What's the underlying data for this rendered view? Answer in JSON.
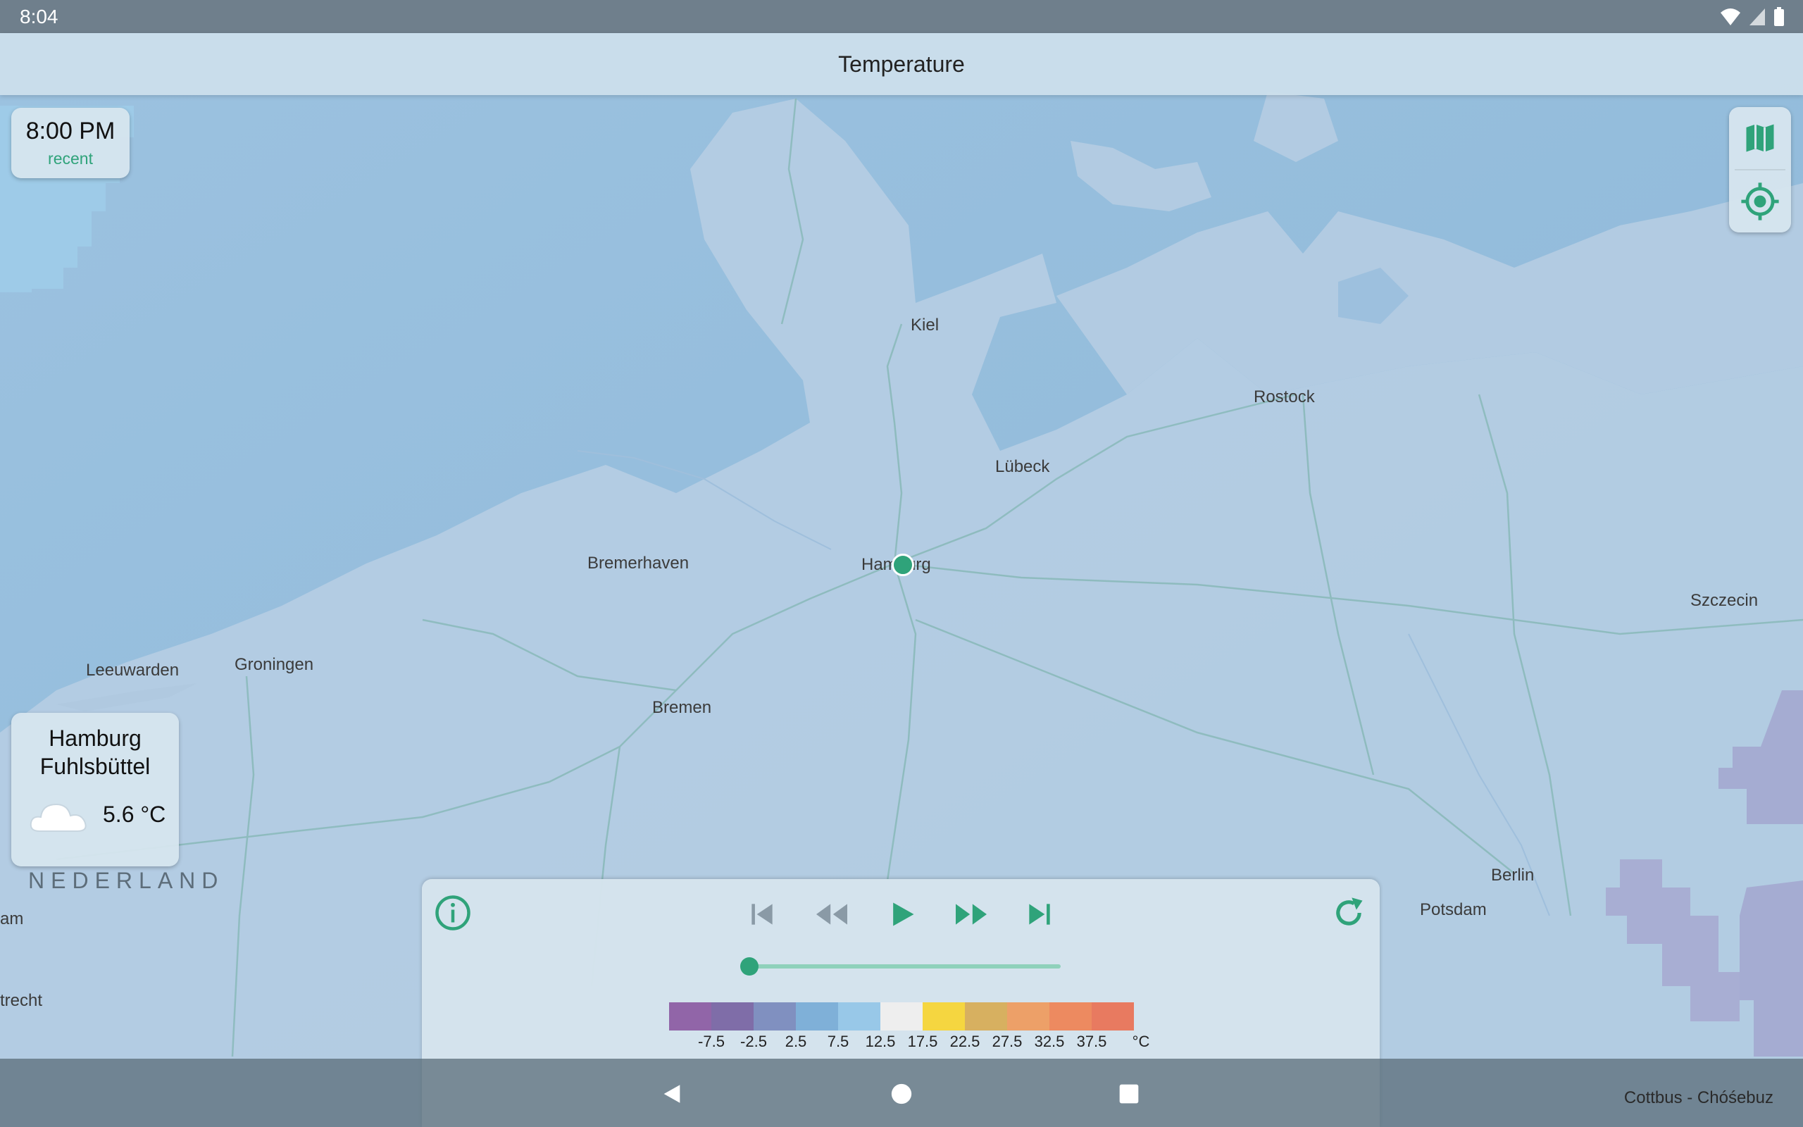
{
  "status_bar": {
    "time": "8:04"
  },
  "app_bar": {
    "title": "Temperature"
  },
  "time_card": {
    "time": "8:00 PM",
    "status": "recent"
  },
  "station_card": {
    "name_line1": "Hamburg",
    "name_line2": "Fuhlsbüttel",
    "temperature": "5.6 °C",
    "condition_icon": "cloud-icon"
  },
  "map": {
    "cities": [
      "Kiel",
      "Rostock",
      "Lübeck",
      "Bremerhaven",
      "Hamburg",
      "Szczecin",
      "Leeuwarden",
      "Groningen",
      "Bremen",
      "Berlin",
      "Potsdam",
      "am",
      "trecht"
    ],
    "country": "NEDERLAND",
    "attribution": "Cottbus - Chóśebuz"
  },
  "player": {
    "buttons": [
      "info-icon",
      "skip-to-start-icon",
      "rewind-icon",
      "play-icon",
      "fast-forward-icon",
      "skip-to-end-icon",
      "refresh-icon"
    ],
    "progress": 0.0
  },
  "legend": {
    "colors": [
      "#9165a8",
      "#7f6da8",
      "#8090c0",
      "#7fb0d8",
      "#98c8e8",
      "#eeeeee",
      "#f5d640",
      "#d7b060",
      "#eda068",
      "#ed8a60",
      "#e87a60"
    ],
    "labels": [
      "-7.5",
      "-2.5",
      "2.5",
      "7.5",
      "12.5",
      "17.5",
      "22.5",
      "27.5",
      "32.5",
      "37.5"
    ],
    "unit": "°C"
  },
  "accent_color": "#2fa37a"
}
